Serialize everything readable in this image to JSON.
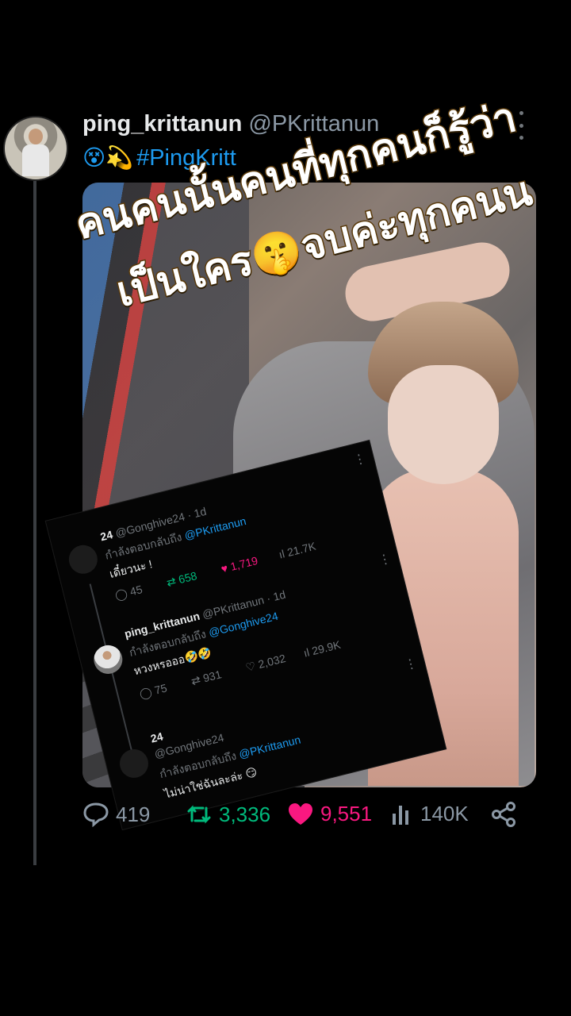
{
  "post": {
    "display_name": "ping_krittanun",
    "handle": "@PKrittanun",
    "emoji": "😵💫",
    "hashtag": "#PingKritt",
    "menu_icon": "more-vertical-icon"
  },
  "caption": {
    "line1": "คนคนนั้นคนที่ทุกคนก็รู้ว่า",
    "line2": "เป็นใคร🤫จบค่ะทุกคนน"
  },
  "actions": {
    "replies": "419",
    "retweets": "3,336",
    "likes": "9,551",
    "views": "140K"
  },
  "colors": {
    "retweet": "#00ba7c",
    "like": "#f91880",
    "link": "#1d9bf0",
    "muted": "#71767b"
  },
  "embedded_thread": {
    "reply1": {
      "name": "24",
      "handle": "@Gonghive24",
      "time": "· 1d",
      "replying_to_label": "กำลังตอบกลับถึง",
      "replying_to": "@PKrittanun",
      "text": "เดี๋ยวนะ !",
      "replies": "45",
      "retweets": "658",
      "likes": "1,719",
      "views": "21.7K"
    },
    "reply2": {
      "name": "ping_krittanun",
      "handle": "@PKrittanun",
      "time": "· 1d",
      "replying_to_label": "กำลังตอบกลับถึง",
      "replying_to": "@Gonghive24",
      "text": "หวงหรอออ🤣🤣",
      "replies": "75",
      "retweets": "931",
      "likes": "2,032",
      "views": "29.9K"
    },
    "reply3": {
      "name": "24",
      "handle": "@Gonghive24",
      "replying_to_label": "กำลังตอบกลับถึง",
      "replying_to": "@PKrittanun",
      "text": "ไม่น่าใช่ฉันละล่ะ 😏"
    }
  }
}
